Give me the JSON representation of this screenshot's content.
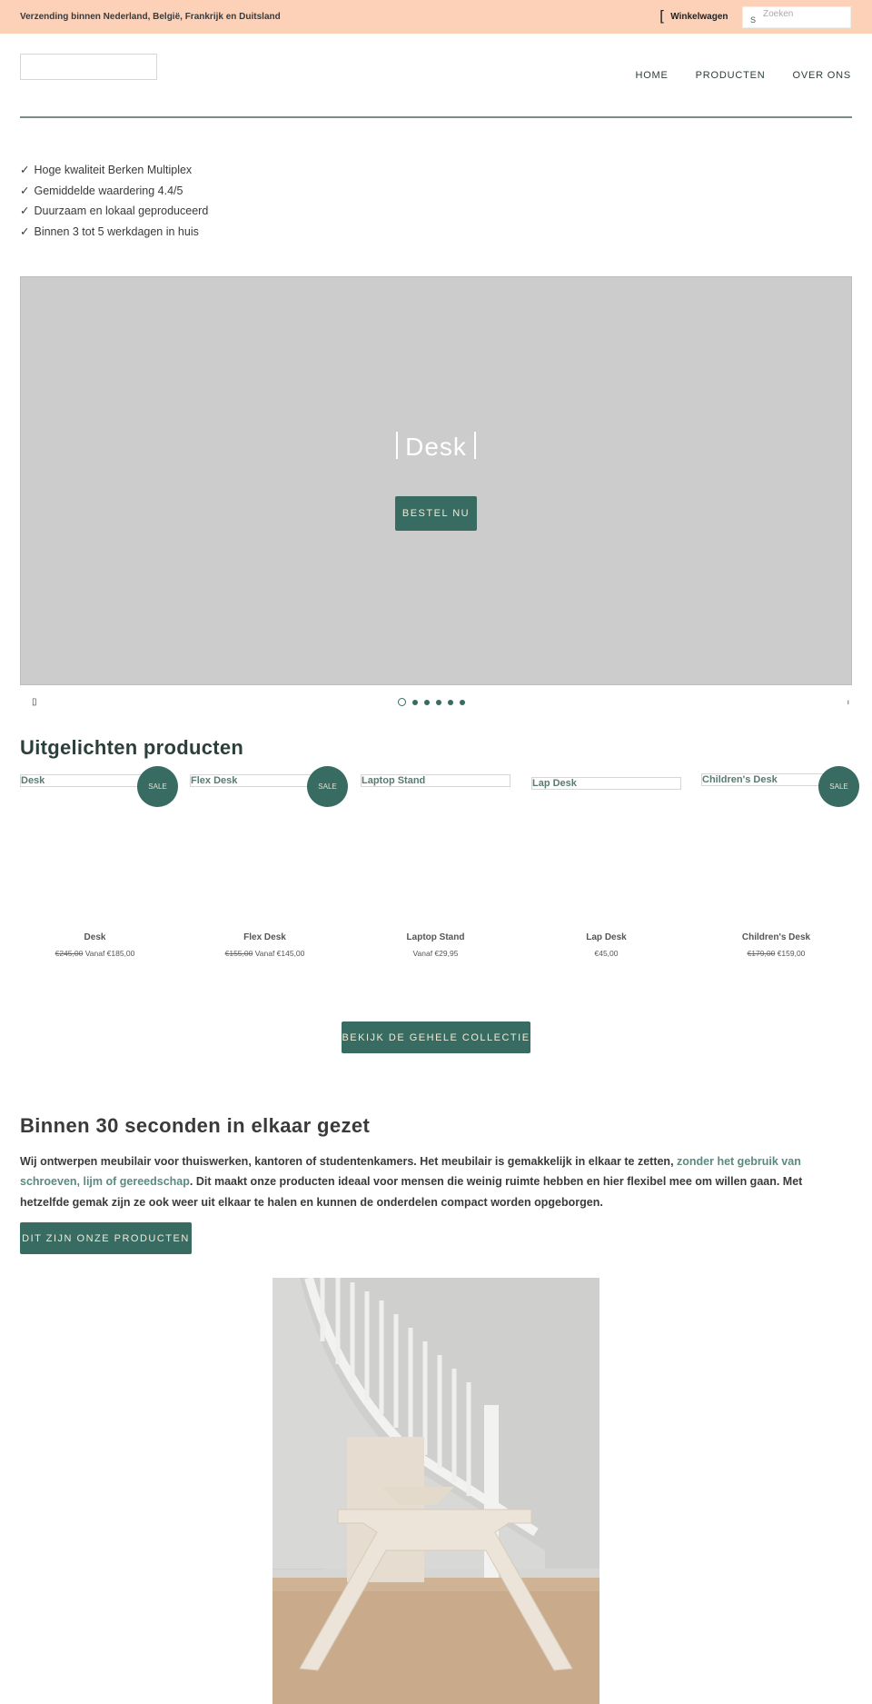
{
  "announcement": {
    "text": "Verzending binnen Nederland, België, Frankrijk en Duitsland",
    "cart_icon": "[",
    "cart_label": "Winkelwagen",
    "search_icon": "S",
    "search_placeholder": "Zoeken",
    "search_value": ""
  },
  "header": {
    "nav": [
      {
        "label": "HOME"
      },
      {
        "label": "PRODUCTEN"
      },
      {
        "label": "OVER ONS"
      }
    ]
  },
  "usps": [
    {
      "check": "✓",
      "text": "Hoge kwaliteit Berken Multiplex"
    },
    {
      "check": "✓",
      "text": "Gemiddelde waardering 4.4/5"
    },
    {
      "check": "✓",
      "text": "Duurzaam en lokaal geproduceerd"
    },
    {
      "check": "✓",
      "text": "Binnen 3 tot 5 werkdagen in huis"
    }
  ],
  "hero": {
    "title": "Desk",
    "button": "BESTEL NU",
    "prev_icon": "▯",
    "next_icon": "ı",
    "slide_count": 6,
    "active_slide": 1
  },
  "featured": {
    "title": "Uitgelichten producten",
    "sale_label": "SALE",
    "products": [
      {
        "name": "Desk",
        "old_price": "€245,00",
        "price": "Vanaf €185,00",
        "sale": true
      },
      {
        "name": "Flex Desk",
        "old_price": "€155,00",
        "price": "Vanaf €145,00",
        "sale": true
      },
      {
        "name": "Laptop Stand",
        "old_price": "",
        "price": "Vanaf €29,95",
        "sale": false
      },
      {
        "name": "Lap Desk",
        "old_price": "",
        "price": "€45,00",
        "sale": false
      },
      {
        "name": "Children's Desk",
        "old_price": "€179,00",
        "price": "€159,00",
        "sale": true
      }
    ],
    "collection_button": "BEKIJK DE GEHELE COLLECTIE"
  },
  "about": {
    "title": "Binnen 30 seconden in elkaar gezet",
    "text_1": "Wij ontwerpen meubilair voor thuiswerken, kantoren of studentenkamers. Het meubilair is gemakkelijk in elkaar te zetten, ",
    "link": "zonder het gebruik van schroeven, lijm of gereedschap",
    "text_2": ". Dit maakt onze producten ideaal voor mensen die weinig ruimte hebben en hier flexibel mee om willen gaan. Met hetzelfde gemak zijn ze ook weer uit elkaar te halen en kunnen de onderdelen compact worden opgeborgen.",
    "button": "DIT ZIJN ONZE PRODUCTEN",
    "photo_alt": "Plywood desk in front of a staircase"
  },
  "colors": {
    "announcement_bg": "#fdd1b8",
    "accent": "#386b62",
    "hero_bg": "#cccccc"
  }
}
